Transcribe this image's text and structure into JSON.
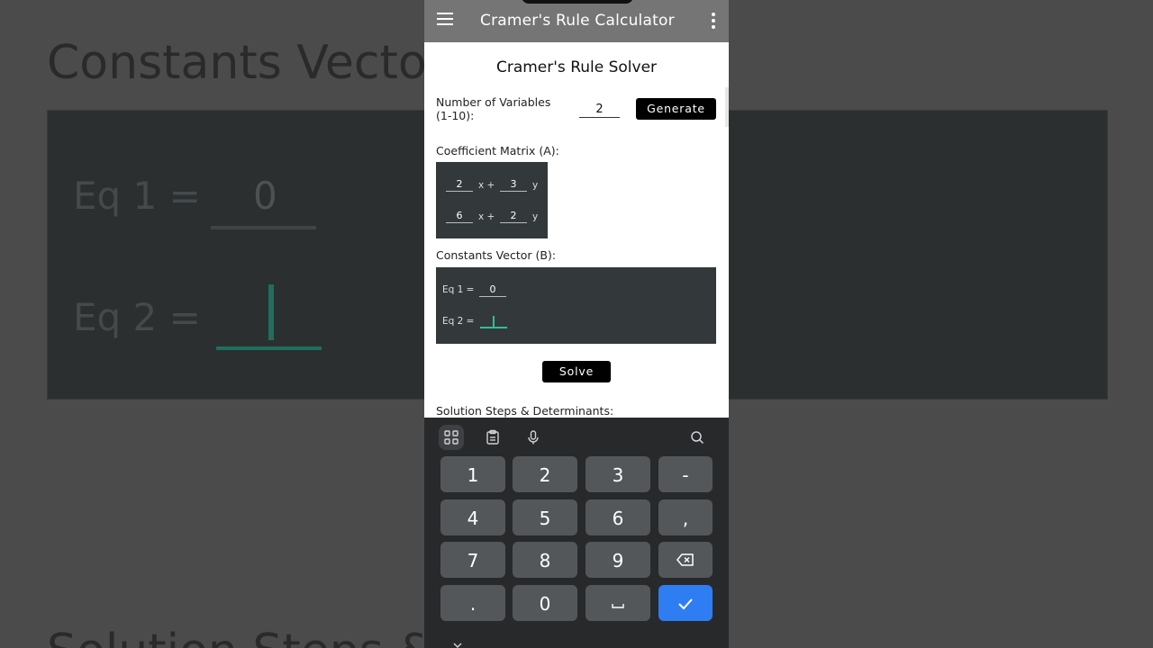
{
  "background": {
    "heading": "Constants Vecto",
    "eq1_label": "Eq 1 =",
    "eq1_value": "0",
    "eq2_label": "Eq 2 =",
    "bottom_text": "Solution Steps &                    :"
  },
  "appbar": {
    "title": "Cramer's Rule Calculator",
    "menu_icon": "hamburger-menu-icon",
    "more_icon": "more-vert-icon",
    "color": "#757575"
  },
  "main": {
    "title": "Cramer's Rule Solver",
    "num_vars_label_line1": "Number of Variables",
    "num_vars_label_line2": "(1-10):",
    "num_vars_value": "2",
    "generate_label": "Generate",
    "coeff_label": "Coefficient Matrix (A):",
    "matrix": [
      [
        {
          "value": "2",
          "var": "x +"
        },
        {
          "value": "3",
          "var": "y"
        }
      ],
      [
        {
          "value": "6",
          "var": "x +"
        },
        {
          "value": "2",
          "var": "y"
        }
      ]
    ],
    "constants_label": "Constants Vector (B):",
    "constants": [
      {
        "label": "Eq 1 =",
        "value": "0"
      },
      {
        "label": "Eq 2 =",
        "value": ""
      }
    ],
    "solve_label": "Solve",
    "steps_label": "Solution Steps & Determinants:"
  },
  "keyboard": {
    "toolbar": [
      "grid-icon",
      "clipboard-icon",
      "mic-icon",
      "search-icon"
    ],
    "rows": [
      [
        "1",
        "2",
        "3",
        "-"
      ],
      [
        "4",
        "5",
        "6",
        ","
      ],
      [
        "7",
        "8",
        "9",
        "backspace"
      ],
      [
        ".",
        "0",
        "space",
        "enter"
      ]
    ],
    "accent": "#2f7df2"
  }
}
